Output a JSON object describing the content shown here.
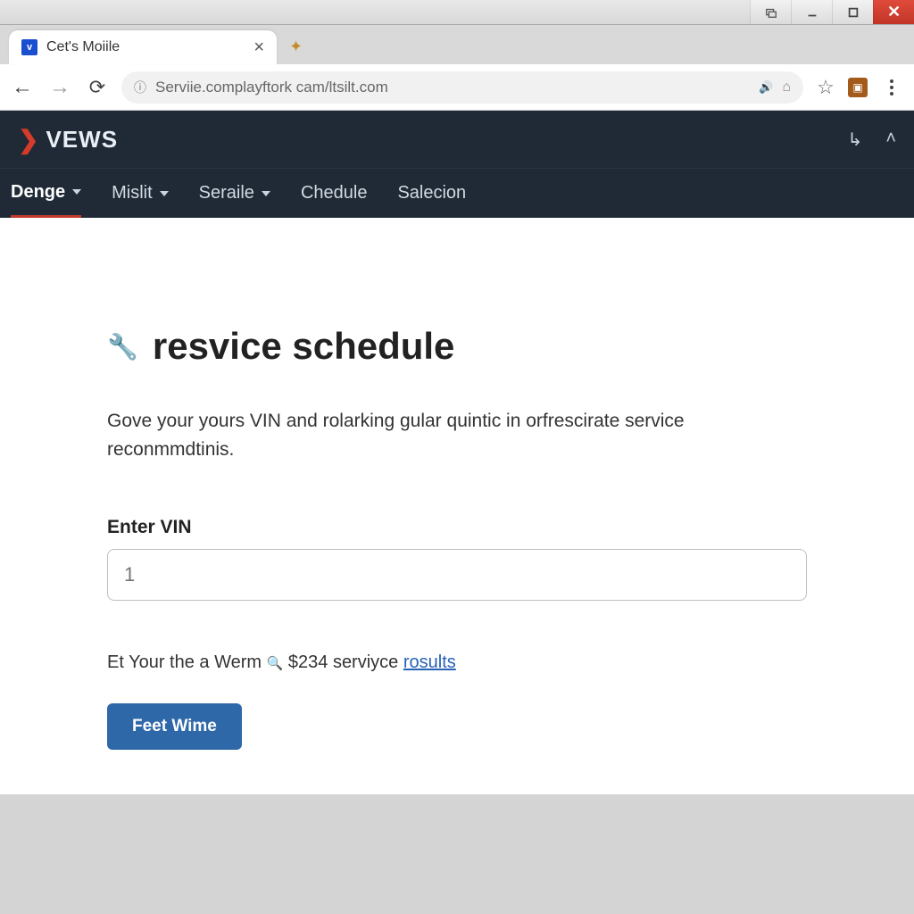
{
  "window": {
    "tab_title": "Cet's Moiile",
    "favicon_letter": "v"
  },
  "browser": {
    "url": "Serviie.complayftork cam/ltsilt.com"
  },
  "site": {
    "brand_mark": "❯",
    "brand_text": "VEWS",
    "nav": [
      {
        "label": "Denge",
        "has_caret": true,
        "active": true
      },
      {
        "label": "Mislit",
        "has_caret": true,
        "active": false
      },
      {
        "label": "Seraile",
        "has_caret": true,
        "active": false
      },
      {
        "label": "Chedule",
        "has_caret": false,
        "active": false
      },
      {
        "label": "Salecion",
        "has_caret": false,
        "active": false
      }
    ]
  },
  "page": {
    "title": "resvice schedule",
    "subtitle": "Gove your yours VIN and rolarking gular quintic in orfrescirate service reconmmdtinis.",
    "vin_label": "Enter VIN",
    "vin_placeholder": "1",
    "results_prefix": "Et Your the a Werm",
    "results_amount": "$234",
    "results_mid": "serviyce",
    "results_link": "rosults",
    "button_label": "Feet Wime"
  }
}
